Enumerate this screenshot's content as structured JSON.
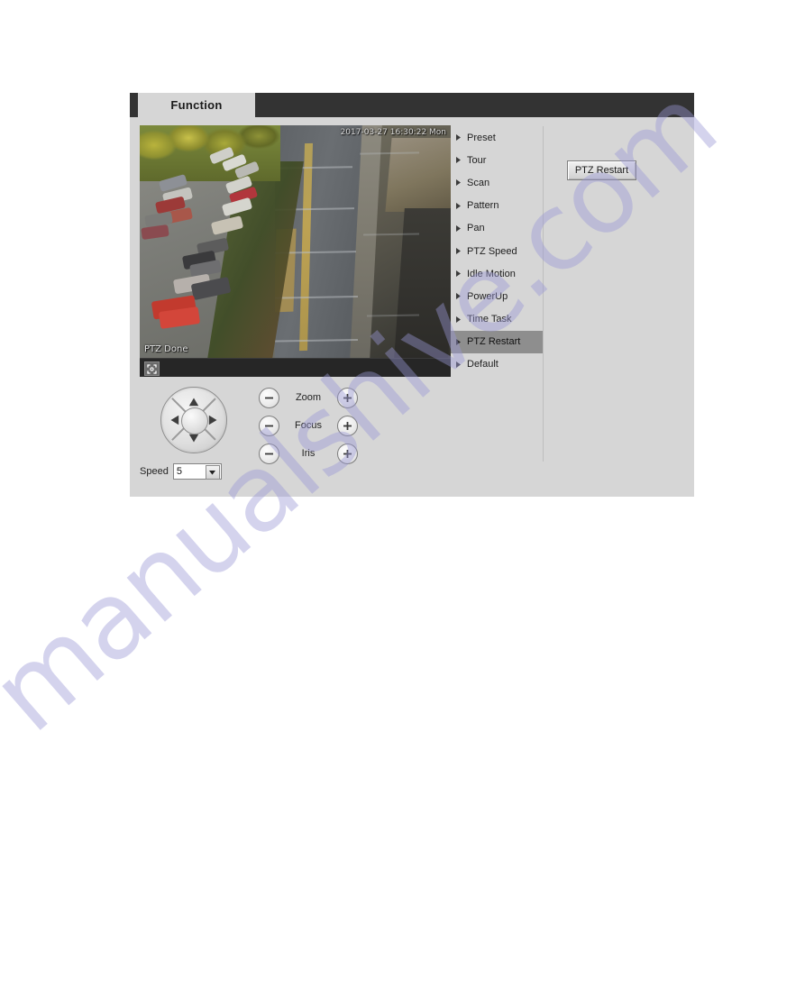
{
  "tab": {
    "label": "Function"
  },
  "video": {
    "timestamp": "2017-03-27 16:30:22 Mon",
    "status_text": "PTZ Done",
    "fullscreen_icon": "fullscreen-icon"
  },
  "ptz": {
    "joystick": {
      "up": "up-arrow-icon",
      "down": "down-arrow-icon",
      "left": "left-arrow-icon",
      "right": "right-arrow-icon",
      "center": "joystick-center"
    },
    "controls": [
      {
        "label": "Zoom",
        "minus": "minus-icon",
        "plus": "plus-icon"
      },
      {
        "label": "Focus",
        "minus": "minus-icon",
        "plus": "plus-icon"
      },
      {
        "label": "Iris",
        "minus": "minus-icon",
        "plus": "plus-icon"
      }
    ],
    "speed": {
      "label": "Speed",
      "value": "5",
      "dropdown_icon": "chevron-down-icon"
    }
  },
  "menu": {
    "items": [
      {
        "label": "Preset",
        "selected": false
      },
      {
        "label": "Tour",
        "selected": false
      },
      {
        "label": "Scan",
        "selected": false
      },
      {
        "label": "Pattern",
        "selected": false
      },
      {
        "label": "Pan",
        "selected": false
      },
      {
        "label": "PTZ Speed",
        "selected": false
      },
      {
        "label": "Idle Motion",
        "selected": false
      },
      {
        "label": "PowerUp",
        "selected": false
      },
      {
        "label": "Time Task",
        "selected": false
      },
      {
        "label": "PTZ Restart",
        "selected": true
      },
      {
        "label": "Default",
        "selected": false
      }
    ]
  },
  "actions": {
    "ptz_restart_label": "PTZ Restart"
  },
  "watermark": {
    "text": "manualshive.com"
  },
  "colors": {
    "panel_bg": "#d6d6d6",
    "tabbar_bg": "#333333",
    "tab_bg": "#d6d6d6",
    "selected_item_bg": "#8e8e8e",
    "watermark": "#9a98d6",
    "text": "#1d1d1d"
  }
}
